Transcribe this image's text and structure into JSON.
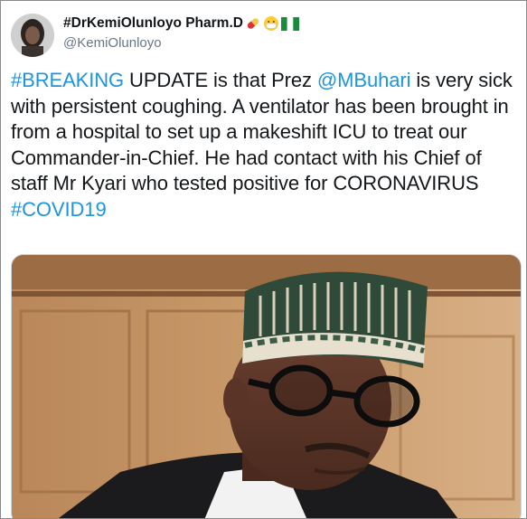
{
  "author": {
    "display_name": "#DrKemiOlunloyo Pharm.D",
    "handle": "@KemiOlunloyo",
    "name_emojis": [
      "pill-icon",
      "mask-face-icon",
      "nigeria-flag-icon"
    ]
  },
  "tweet": {
    "segments": [
      {
        "text": "#BREAKING",
        "link": true
      },
      {
        "text": " UPDATE is that Prez ",
        "link": false
      },
      {
        "text": "@MBuhari",
        "link": true
      },
      {
        "text": " is very sick with persistent coughing. A ventilator has been brought in from a  hospital to set up a makeshift ICU to treat our Commander-in-Chief. He had contact with his Chief of staff Mr Kyari who tested positive for CORONAVIRUS ",
        "link": false
      },
      {
        "text": "#COVID19",
        "link": true
      }
    ]
  },
  "colors": {
    "link": "#1b95e0",
    "text": "#14171a",
    "secondary": "#657786"
  },
  "media": {
    "subject": "photo-of-man-in-patterned-cap-and-glasses"
  }
}
